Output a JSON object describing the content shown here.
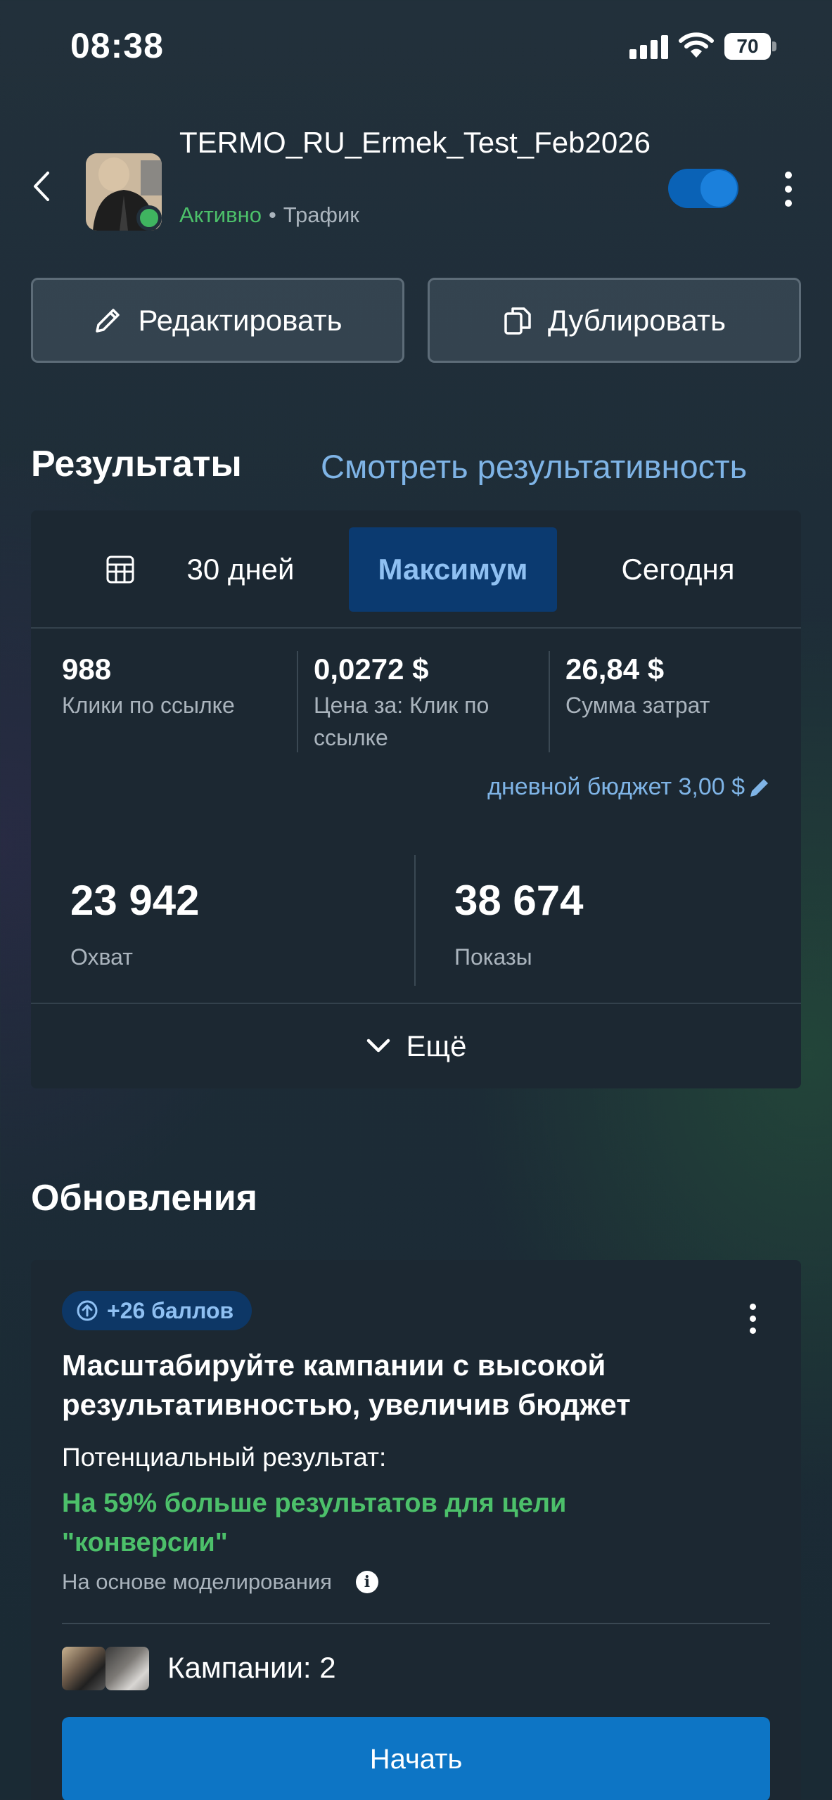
{
  "status_bar": {
    "time": "08:38",
    "battery": "70"
  },
  "header": {
    "campaign_name": "TERMO_RU_Ermek_Test_Feb2026",
    "status": "Активно",
    "separator": "•",
    "objective": "Трафик",
    "toggle_on": true
  },
  "actions": {
    "edit_label": "Редактировать",
    "duplicate_label": "Дублировать"
  },
  "results": {
    "title": "Результаты",
    "view_performance": "Смотреть результативность",
    "periods": [
      {
        "label": "30 дней",
        "selected": false
      },
      {
        "label": "Максимум",
        "selected": true
      },
      {
        "label": "Сегодня",
        "selected": false
      }
    ],
    "metrics": [
      {
        "value": "988",
        "label": "Клики по ссылке"
      },
      {
        "value": "0,0272 $",
        "label": "Цена за: Клик по ссылке"
      },
      {
        "value": "26,84 $",
        "label": "Сумма затрат"
      }
    ],
    "daily_budget": "дневной бюджет 3,00 $",
    "big_metrics": [
      {
        "value": "23 942",
        "label": "Охват"
      },
      {
        "value": "38 674",
        "label": "Показы"
      }
    ],
    "more_label": "Ещё"
  },
  "updates": {
    "title": "Обновления",
    "badge": "+26 баллов",
    "card_title": "Масштабируйте кампании с высокой результативностью, увеличив бюджет",
    "potential_label": "Потенциальный результат:",
    "potential_result": "На 59% больше результатов для цели \"конверсии\"",
    "basis": "На основе моделирования",
    "campaigns": "Кампании: 2",
    "start_label": "Начать"
  },
  "colors": {
    "accent_blue": "#0d75c5",
    "link_blue": "#7fb4e6",
    "active_green": "#4cc06a",
    "card_bg": "#1c2832"
  }
}
